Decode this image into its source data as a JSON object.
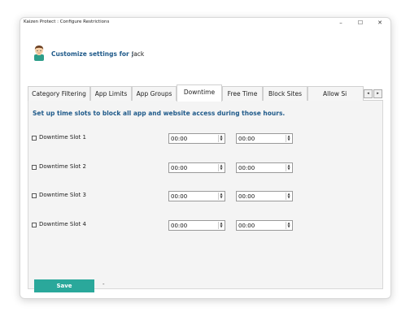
{
  "window": {
    "title": "Kaizen Protect : Configure Restrictions",
    "minimize": "–",
    "maximize": "☐",
    "close": "✕"
  },
  "header": {
    "customize_label": "Customize settings for :",
    "user_name": "Jack",
    "avatar_icon": "user-avatar-icon"
  },
  "tabs": [
    {
      "label": "Category Filtering"
    },
    {
      "label": "App Limits"
    },
    {
      "label": "App Groups"
    },
    {
      "label": "Downtime",
      "active": true
    },
    {
      "label": "Free Time"
    },
    {
      "label": "Block Sites"
    },
    {
      "label": "Allow Si"
    }
  ],
  "tab_scroll": {
    "left": "◂",
    "right": "▸"
  },
  "downtime": {
    "instruction": "Set up time slots to block all app and website access during those hours.",
    "slots": [
      {
        "label": "Downtime Slot 1",
        "checked": false,
        "start": "00:00",
        "end": "00:00"
      },
      {
        "label": "Downtime Slot 2",
        "checked": false,
        "start": "00:00",
        "end": "00:00"
      },
      {
        "label": "Downtime Slot 3",
        "checked": false,
        "start": "00:00",
        "end": "00:00"
      },
      {
        "label": "Downtime Slot 4",
        "checked": false,
        "start": "00:00",
        "end": "00:00"
      }
    ]
  },
  "footer": {
    "save_label": "Save",
    "status_text": "-"
  },
  "colors": {
    "accent": "#2aa89b",
    "heading_blue": "#1f5a8a"
  },
  "spinner": {
    "up": "▲",
    "down": "▼"
  }
}
